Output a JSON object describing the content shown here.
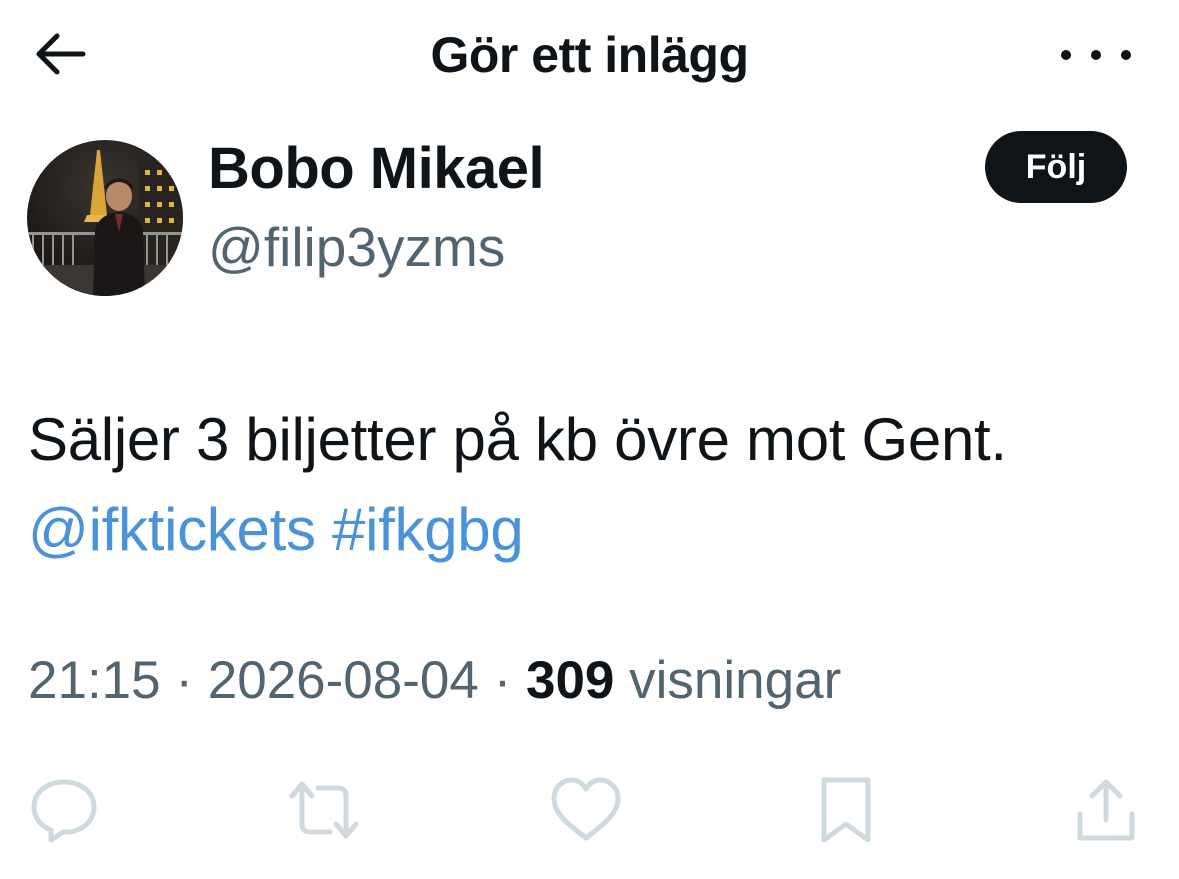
{
  "header": {
    "title": "Gör ett inlägg",
    "back_icon": "arrow-left-icon",
    "more_icon": "more-horizontal-icon"
  },
  "author": {
    "display_name": "Bobo Mikael",
    "handle": "@filip3yzms",
    "follow_label": "Följ",
    "avatar_description_icon": "avatar"
  },
  "tweet": {
    "text_line1": "Säljer 3 biljetter på kb övre mot Gent.",
    "mention": "@ifktickets",
    "hashtag": "#ifkgbg"
  },
  "meta": {
    "time": "21:15",
    "separator": " · ",
    "date": "2026-08-04",
    "views_count": "309",
    "views_label": "visningar"
  },
  "actions": {
    "reply_icon": "reply-icon",
    "retweet_icon": "retweet-icon",
    "like_icon": "heart-icon",
    "bookmark_icon": "bookmark-icon",
    "share_icon": "share-icon"
  },
  "colors": {
    "text_primary": "#0f1419",
    "text_secondary": "#536471",
    "link": "#4a93d9",
    "icon_light": "#cfd9de"
  }
}
